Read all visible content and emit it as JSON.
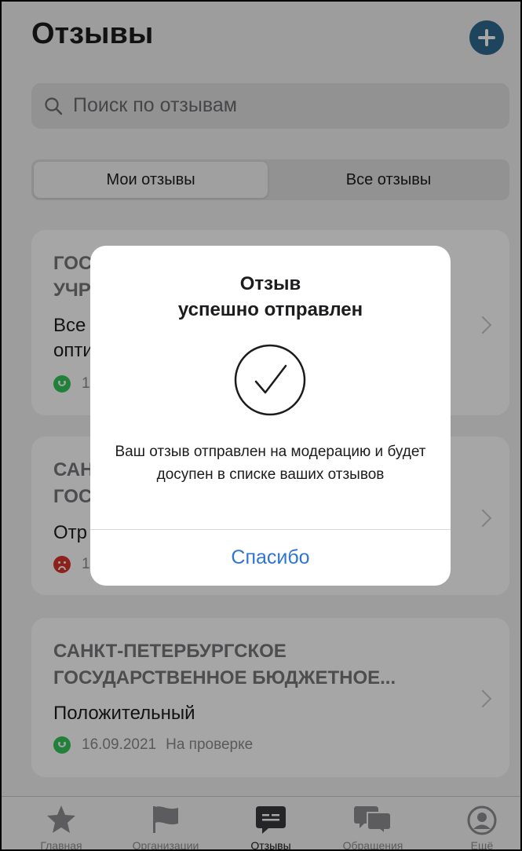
{
  "header": {
    "title": "Отзывы"
  },
  "search": {
    "placeholder": "Поиск по отзывам"
  },
  "segments": {
    "mine": "Мои отзывы",
    "all": "Все отзывы"
  },
  "reviews": [
    {
      "title": "ГОС\nУЧР",
      "status": "Все\nопти",
      "mood": "positive",
      "date": "1"
    },
    {
      "title": "САН\nГОС",
      "status": "Отр",
      "mood": "negative",
      "date": "1"
    },
    {
      "title": "САНКТ-ПЕТЕРБУРГСКОЕ\nГОСУДАРСТВЕННОЕ БЮДЖЕТНОЕ...",
      "status": "Положительный",
      "mood": "positive",
      "date": "16.09.2021",
      "state": "На проверке"
    }
  ],
  "dialog": {
    "title": "Отзыв\nуспешно отправлен",
    "message": "Ваш отзыв отправлен на модерацию и будет досупен в списке ваших отзывов",
    "button": "Спасибо"
  },
  "tabbar": [
    {
      "label": "Главная",
      "icon": "star-icon"
    },
    {
      "label": "Организации",
      "icon": "flag-icon"
    },
    {
      "label": "Отзывы",
      "icon": "review-icon",
      "active": true
    },
    {
      "label": "Обращения",
      "icon": "chat-bubbles-icon"
    },
    {
      "label": "Ещё",
      "icon": "profile-icon"
    }
  ],
  "colors": {
    "accent": "#2f6b8f",
    "link": "#2f76d2",
    "positive": "#34c759",
    "negative": "#d9342b"
  }
}
